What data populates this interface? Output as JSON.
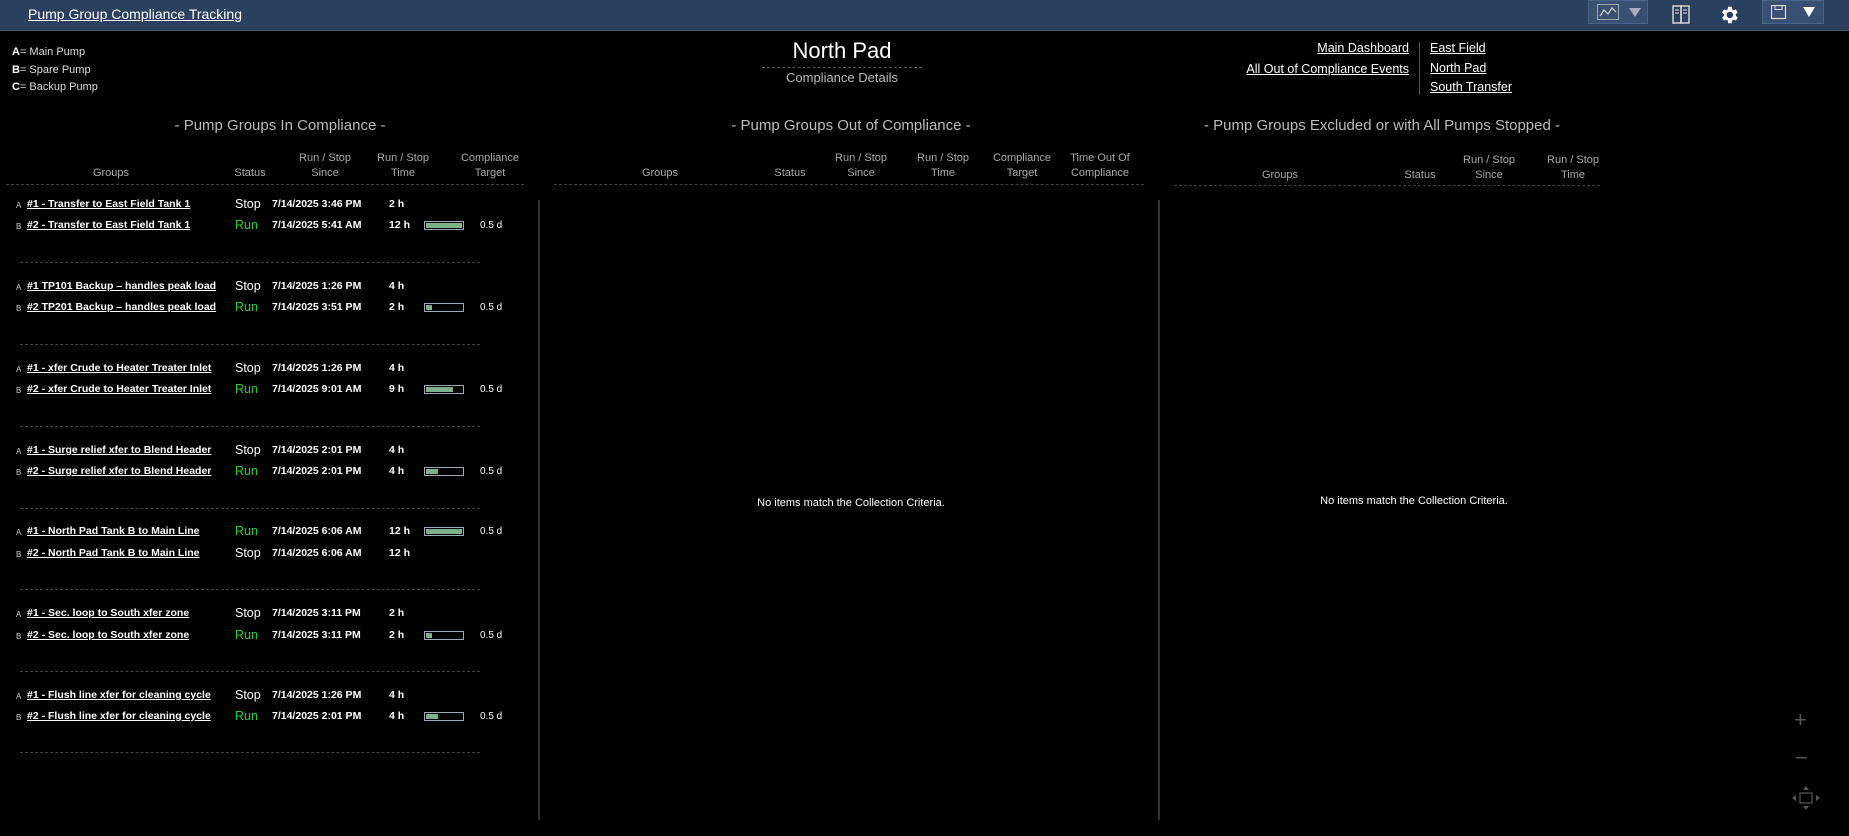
{
  "app": {
    "title": "Pump Group Compliance Tracking"
  },
  "toolbar": {
    "icons": [
      "trend-icon",
      "dropdown-icon",
      "book-icon",
      "gear-icon",
      "save-icon",
      "dropdown-icon"
    ]
  },
  "legend": [
    {
      "key": "A",
      "text": "= Main Pump"
    },
    {
      "key": "B",
      "text": "= Spare Pump"
    },
    {
      "key": "C",
      "text": "= Backup Pump"
    }
  ],
  "page": {
    "title": "North Pad",
    "subtitle": "Compliance Details"
  },
  "nav": {
    "main_dashboard": "Main Dashboard",
    "all_out": "All Out of Compliance Events",
    "east_field": "East Field",
    "north_pad": "North Pad",
    "south_transfer": "South Transfer"
  },
  "in_compliance": {
    "title": "- Pump Groups In Compliance -",
    "headers": {
      "groups": "Groups",
      "status": "Status",
      "since_1": "Run / Stop",
      "since_2": "Since",
      "time_1": "Run / Stop",
      "time_2": "Time",
      "target_1": "Compliance",
      "target_2": "Target"
    },
    "groups": [
      {
        "rows": [
          {
            "letter": "A",
            "name": "#1 - Transfer to East Field Tank 1",
            "status": "Stop",
            "since": "7/14/2025 3:46 PM",
            "time": "2 h",
            "progress": null,
            "target": ""
          },
          {
            "letter": "B",
            "name": "#2 - Transfer to East Field Tank 1",
            "status": "Run",
            "since": "7/14/2025 5:41 AM",
            "time": "12 h",
            "progress": 1.0,
            "target": "0.5 d"
          }
        ]
      },
      {
        "rows": [
          {
            "letter": "A",
            "name": "#1 TP101 Backup – handles peak load",
            "status": "Stop",
            "since": "7/14/2025 1:26 PM",
            "time": "4 h",
            "progress": null,
            "target": ""
          },
          {
            "letter": "B",
            "name": "#2 TP201 Backup – handles peak load",
            "status": "Run",
            "since": "7/14/2025 3:51 PM",
            "time": "2 h",
            "progress": 0.17,
            "target": "0.5 d"
          }
        ]
      },
      {
        "rows": [
          {
            "letter": "A",
            "name": "#1 - xfer Crude to Heater Treater Inlet",
            "status": "Stop",
            "since": "7/14/2025 1:26 PM",
            "time": "4 h",
            "progress": null,
            "target": ""
          },
          {
            "letter": "B",
            "name": "#2 - xfer Crude to Heater Treater Inlet",
            "status": "Run",
            "since": "7/14/2025 9:01 AM",
            "time": "9 h",
            "progress": 0.75,
            "target": "0.5 d"
          }
        ]
      },
      {
        "rows": [
          {
            "letter": "A",
            "name": "#1 - Surge relief xfer to Blend Header",
            "status": "Stop",
            "since": "7/14/2025 2:01 PM",
            "time": "4 h",
            "progress": null,
            "target": ""
          },
          {
            "letter": "B",
            "name": "#2 - Surge relief xfer to Blend Header",
            "status": "Run",
            "since": "7/14/2025 2:01 PM",
            "time": "4 h",
            "progress": 0.33,
            "target": "0.5 d"
          }
        ]
      },
      {
        "rows": [
          {
            "letter": "A",
            "name": "#1 - North Pad Tank B to Main Line",
            "status": "Run",
            "since": "7/14/2025 6:06 AM",
            "time": "12 h",
            "progress": 1.0,
            "target": "0.5 d"
          },
          {
            "letter": "B",
            "name": "#2 - North Pad Tank B to Main Line",
            "status": "Stop",
            "since": "7/14/2025 6:06 AM",
            "time": "12 h",
            "progress": null,
            "target": ""
          }
        ]
      },
      {
        "rows": [
          {
            "letter": "A",
            "name": "#1 - Sec. loop to South xfer zone",
            "status": "Stop",
            "since": "7/14/2025 3:11 PM",
            "time": "2 h",
            "progress": null,
            "target": ""
          },
          {
            "letter": "B",
            "name": "#2 - Sec. loop to South xfer zone",
            "status": "Run",
            "since": "7/14/2025 3:11 PM",
            "time": "2 h",
            "progress": 0.17,
            "target": "0.5 d"
          }
        ]
      },
      {
        "rows": [
          {
            "letter": "A",
            "name": "#1 - Flush line xfer for cleaning cycle",
            "status": "Stop",
            "since": "7/14/2025 1:26 PM",
            "time": "4 h",
            "progress": null,
            "target": ""
          },
          {
            "letter": "B",
            "name": "#2 - Flush line xfer for cleaning cycle",
            "status": "Run",
            "since": "7/14/2025 2:01 PM",
            "time": "4 h",
            "progress": 0.33,
            "target": "0.5 d"
          }
        ]
      }
    ]
  },
  "out_of_compliance": {
    "title": "- Pump Groups Out of Compliance -",
    "headers": {
      "groups": "Groups",
      "status": "Status",
      "since_1": "Run / Stop",
      "since_2": "Since",
      "time_1": "Run / Stop",
      "time_2": "Time",
      "target_1": "Compliance",
      "target_2": "Target",
      "tooc_1": "Time Out Of",
      "tooc_2": "Compliance"
    },
    "empty": "No items match the Collection Criteria."
  },
  "excluded": {
    "title": "- Pump Groups Excluded or with All Pumps Stopped -",
    "headers": {
      "groups": "Groups",
      "status": "Status",
      "since_1": "Run / Stop",
      "since_2": "Since",
      "time_1": "Run / Stop",
      "time_2": "Time"
    },
    "empty": "No items match the Collection Criteria."
  },
  "colors": {
    "topbar": "#2b3f5f",
    "run": "#2ecc40",
    "bar_fill": "#7fb08c",
    "background": "#000000"
  }
}
